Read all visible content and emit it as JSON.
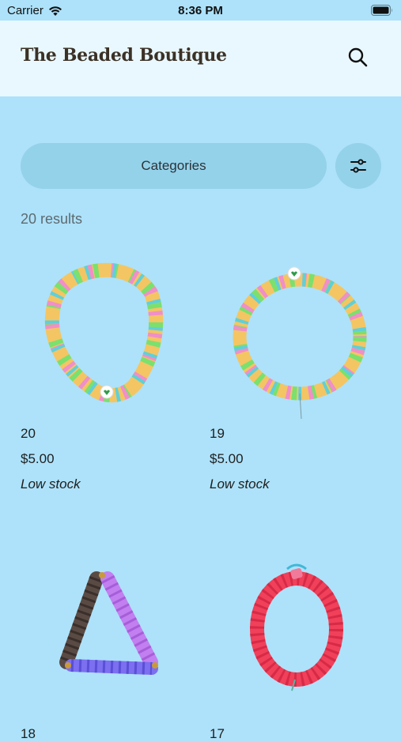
{
  "status_bar": {
    "carrier": "Carrier",
    "time": "8:36 PM"
  },
  "header": {
    "title": "The Beaded Boutique"
  },
  "controls": {
    "categories_label": "Categories"
  },
  "results": {
    "count_label": "20 results"
  },
  "products": [
    {
      "name": "20",
      "price": "$5.00",
      "stock": "Low stock"
    },
    {
      "name": "19",
      "price": "$5.00",
      "stock": "Low stock"
    },
    {
      "name": "18",
      "price": "",
      "stock": ""
    },
    {
      "name": "17",
      "price": "",
      "stock": ""
    }
  ],
  "colors": {
    "background": "#ade2fa",
    "header": "#e9f8fe",
    "button": "#94d2ea",
    "brand_text": "#3b3126"
  }
}
